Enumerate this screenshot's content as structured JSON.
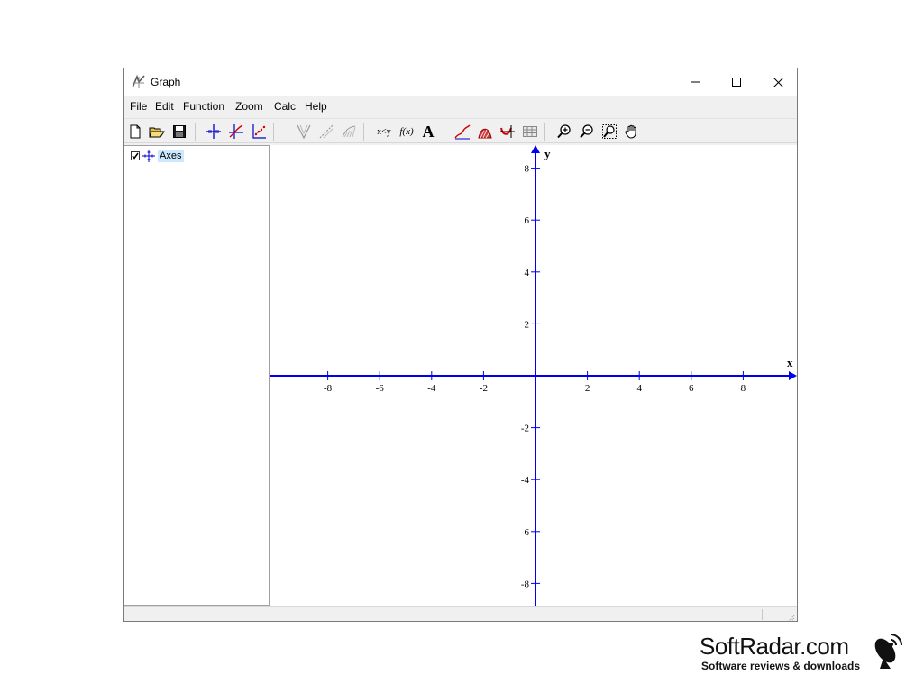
{
  "window": {
    "title": "Graph"
  },
  "menu": {
    "items": [
      "File",
      "Edit",
      "Function",
      "Zoom",
      "Calc",
      "Help"
    ]
  },
  "toolbar": {
    "buttons": [
      {
        "name": "new-file-icon"
      },
      {
        "name": "open-folder-icon"
      },
      {
        "name": "save-icon"
      },
      {
        "name": "axes-icon"
      },
      {
        "name": "insert-function-icon"
      },
      {
        "name": "insert-point-series-icon"
      },
      {
        "name": "insert-tangent-icon"
      },
      {
        "name": "insert-shading-icon"
      },
      {
        "name": "insert-relation-icon"
      },
      {
        "name": "insert-text-label-icon"
      },
      {
        "name": "trendline-icon"
      },
      {
        "name": "area-icon"
      },
      {
        "name": "evaluate-icon"
      },
      {
        "name": "table-icon"
      },
      {
        "name": "zoom-in-icon"
      },
      {
        "name": "zoom-out-icon"
      },
      {
        "name": "zoom-square-icon"
      },
      {
        "name": "hand-pan-icon"
      }
    ],
    "labels": {
      "xy": "x<y",
      "fx": "f(x)",
      "text": "A"
    }
  },
  "tree": {
    "items": [
      {
        "label": "Axes",
        "checked": true
      }
    ]
  },
  "graph": {
    "axis_color": "#0000ee",
    "x_axis_label": "x",
    "y_axis_label": "y",
    "x_ticks": [
      "-8",
      "-6",
      "-4",
      "-2",
      "2",
      "4",
      "6",
      "8"
    ],
    "y_ticks": [
      "8",
      "6",
      "4",
      "2",
      "-2",
      "-4",
      "-6",
      "-8"
    ],
    "x_tick_values": [
      -8,
      -6,
      -4,
      -2,
      2,
      4,
      6,
      8
    ],
    "y_tick_values": [
      8,
      6,
      4,
      2,
      -2,
      -4,
      -6,
      -8
    ],
    "xlim": [
      -10.1,
      10
    ]
  },
  "watermark": {
    "title": "SoftRadar.com",
    "subtitle": "Software reviews & downloads"
  }
}
